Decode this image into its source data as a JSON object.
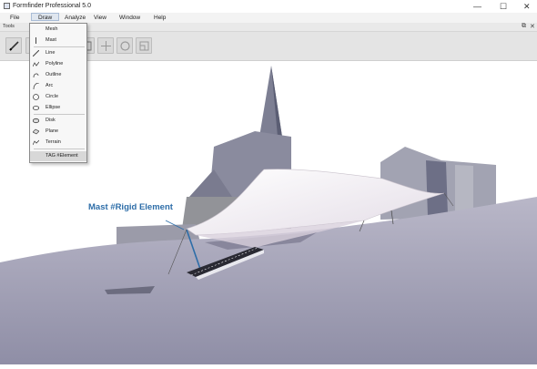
{
  "window": {
    "title": "Formfinder Professional 5.0",
    "minimize_glyph": "—",
    "maximize_glyph": "☐",
    "close_glyph": "✕"
  },
  "menubar": {
    "items": [
      {
        "label": "File"
      },
      {
        "label": "Draw",
        "active": true
      },
      {
        "label": "Analyze"
      },
      {
        "label": "View"
      },
      {
        "label": "Window"
      },
      {
        "label": "Help"
      }
    ]
  },
  "tools_panel": {
    "label": "Tools",
    "buttons": [
      {
        "icon": "pencil-icon"
      },
      {
        "icon": "hidden-tool-icon"
      },
      {
        "icon": "hidden-tool-icon"
      },
      {
        "icon": "select-frame-icon"
      },
      {
        "icon": "move-cross-icon"
      },
      {
        "icon": "rotate-circle-icon"
      },
      {
        "icon": "scale-square-icon"
      }
    ]
  },
  "draw_menu": {
    "items": [
      {
        "label": "Mesh",
        "icon": "none"
      },
      {
        "label": "Mast",
        "icon": "mast-icon"
      },
      {
        "label": "Line",
        "icon": "line-icon"
      },
      {
        "label": "Polyline",
        "icon": "polyline-icon"
      },
      {
        "label": "Outline",
        "icon": "outline-icon"
      },
      {
        "label": "Arc",
        "icon": "arc-icon"
      },
      {
        "label": "Circle",
        "icon": "circle-icon"
      },
      {
        "label": "Ellipse",
        "icon": "ellipse-icon"
      },
      {
        "label": "Disk",
        "icon": "disk-icon"
      },
      {
        "label": "Plane",
        "icon": "plane-icon"
      },
      {
        "label": "Terrain",
        "icon": "terrain-icon"
      },
      {
        "label": "TAG #Element",
        "icon": "none",
        "highlighted": true
      }
    ]
  },
  "viewport": {
    "annotation": "Mast  #Rigid Element",
    "annotation_color": "#2d6da8"
  },
  "colors": {
    "menu_active_bg": "#dfe6ef",
    "toolbar_bg": "#e4e4e4",
    "ground": "#a9a9bd",
    "membrane": "#f2eef3"
  }
}
